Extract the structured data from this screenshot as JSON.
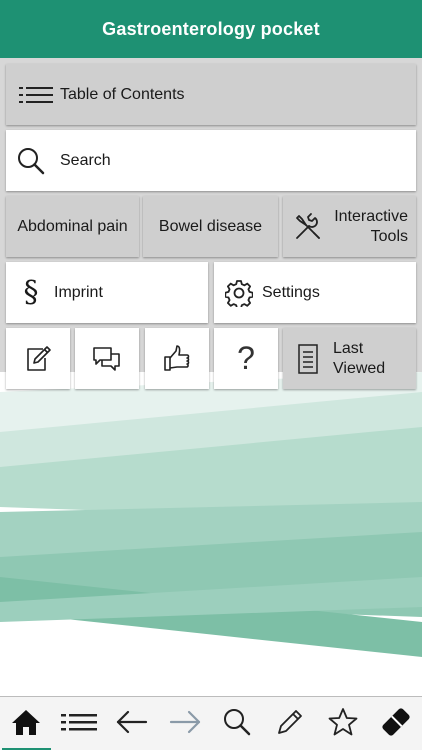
{
  "header": {
    "title": "Gastroenterology pocket"
  },
  "menu": {
    "toc_label": "Table of Contents",
    "search_label": "Search",
    "abdominal_label": "Abdominal pain",
    "bowel_label": "Bowel disease",
    "tools_label": "Interactive\nTools",
    "imprint_label": "Imprint",
    "imprint_symbol": "§",
    "settings_label": "Settings",
    "help_symbol": "?",
    "last_viewed_label": "Last\nViewed"
  },
  "icons": {
    "toc": "list-icon",
    "search": "search-icon",
    "tools": "tools-icon",
    "imprint": "paragraph-icon",
    "settings": "gear-icon",
    "notes": "note-edit-icon",
    "chat": "chat-icon",
    "like": "thumbs-up-icon",
    "help": "question-icon",
    "last_viewed": "document-icon"
  },
  "tabbar": {
    "items": [
      "home-icon",
      "list-icon",
      "arrow-left-icon",
      "arrow-right-icon",
      "search-icon",
      "pencil-icon",
      "star-icon",
      "eraser-icon"
    ],
    "active_index": 0
  },
  "colors": {
    "brand": "#1e9173",
    "tile_gray": "#cfcfcf",
    "backdrop": "#d7d7d7",
    "disabled_arrow": "#8a9aa8"
  }
}
